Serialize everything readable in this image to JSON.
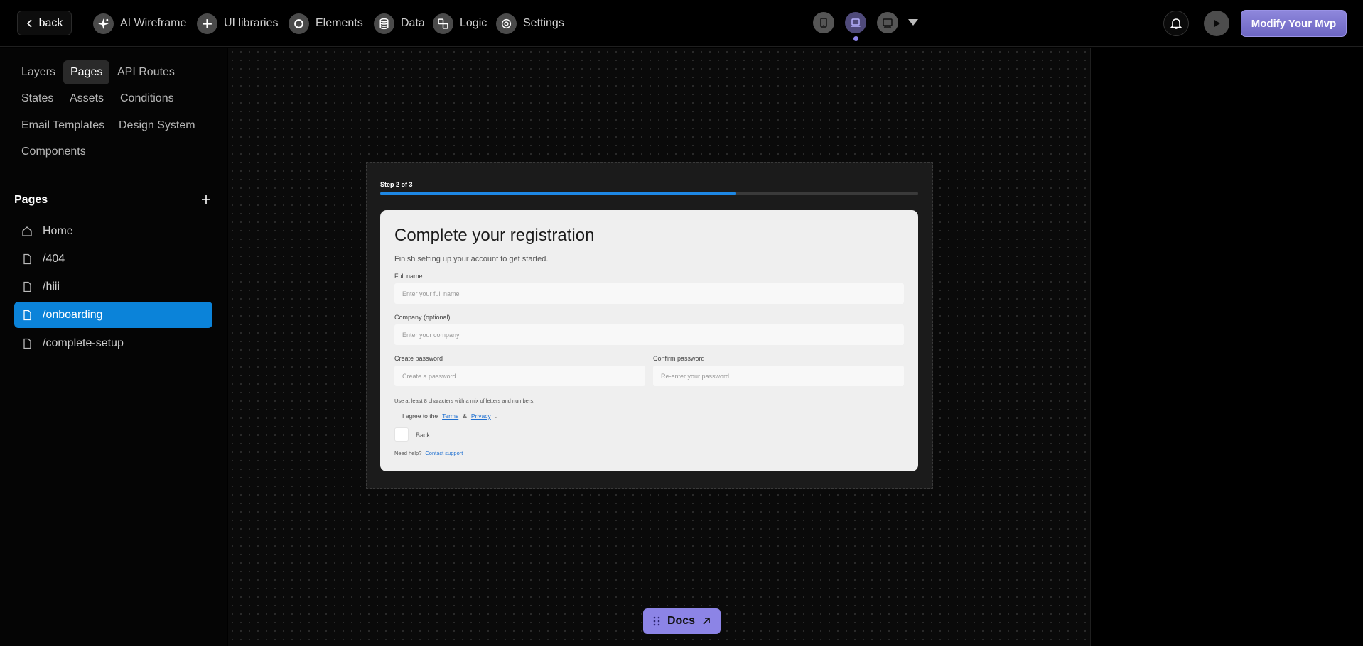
{
  "topbar": {
    "back_label": "back",
    "nav": [
      {
        "label": "AI Wireframe",
        "icon": "sparkle-icon"
      },
      {
        "label": "UI libraries",
        "icon": "plus-icon"
      },
      {
        "label": "Elements",
        "icon": "circle-icon"
      },
      {
        "label": "Data",
        "icon": "database-icon"
      },
      {
        "label": "Logic",
        "icon": "logic-icon"
      },
      {
        "label": "Settings",
        "icon": "settings-icon"
      }
    ],
    "devices": [
      "tablet-icon",
      "laptop-icon",
      "desktop-icon"
    ],
    "active_device": "laptop-icon",
    "modify_label": "Modify Your Mvp"
  },
  "sidebar": {
    "tabs": [
      "Layers",
      "Pages",
      "API Routes",
      "States",
      "Assets",
      "Conditions",
      "Email Templates",
      "Design System",
      "Components"
    ],
    "active_tab": "Pages",
    "pages_title": "Pages",
    "pages": [
      {
        "label": "Home",
        "icon": "home-icon"
      },
      {
        "label": "/404",
        "icon": "file-icon"
      },
      {
        "label": "/hiii",
        "icon": "file-icon"
      },
      {
        "label": "/onboarding",
        "icon": "file-icon"
      },
      {
        "label": "/complete-setup",
        "icon": "file-icon"
      }
    ],
    "active_page": "/onboarding"
  },
  "preview": {
    "step_label": "Step 2 of 3",
    "progress_fraction": 0.66,
    "title": "Complete your registration",
    "subtitle": "Finish setting up your account to get started.",
    "full_name_label": "Full name",
    "full_name_placeholder": "Enter your full name",
    "company_label": "Company (optional)",
    "company_placeholder": "Enter your company",
    "password_label": "Create password",
    "password_placeholder": "Create a password",
    "confirm_label": "Confirm password",
    "confirm_placeholder": "Re-enter your password",
    "hint": "Use at least 8 characters with a mix of letters and numbers.",
    "agree_prefix": "I agree to the",
    "terms": "Terms",
    "amp": "&",
    "privacy": "Privacy",
    "agree_suffix": ".",
    "back_label": "Back",
    "help_prefix": "Need help?",
    "help_link": "Contact support"
  },
  "docs_label": "Docs",
  "colors": {
    "accent": "#8c84e6",
    "active_page": "#0b83d9",
    "progress": "#1e88e5"
  }
}
